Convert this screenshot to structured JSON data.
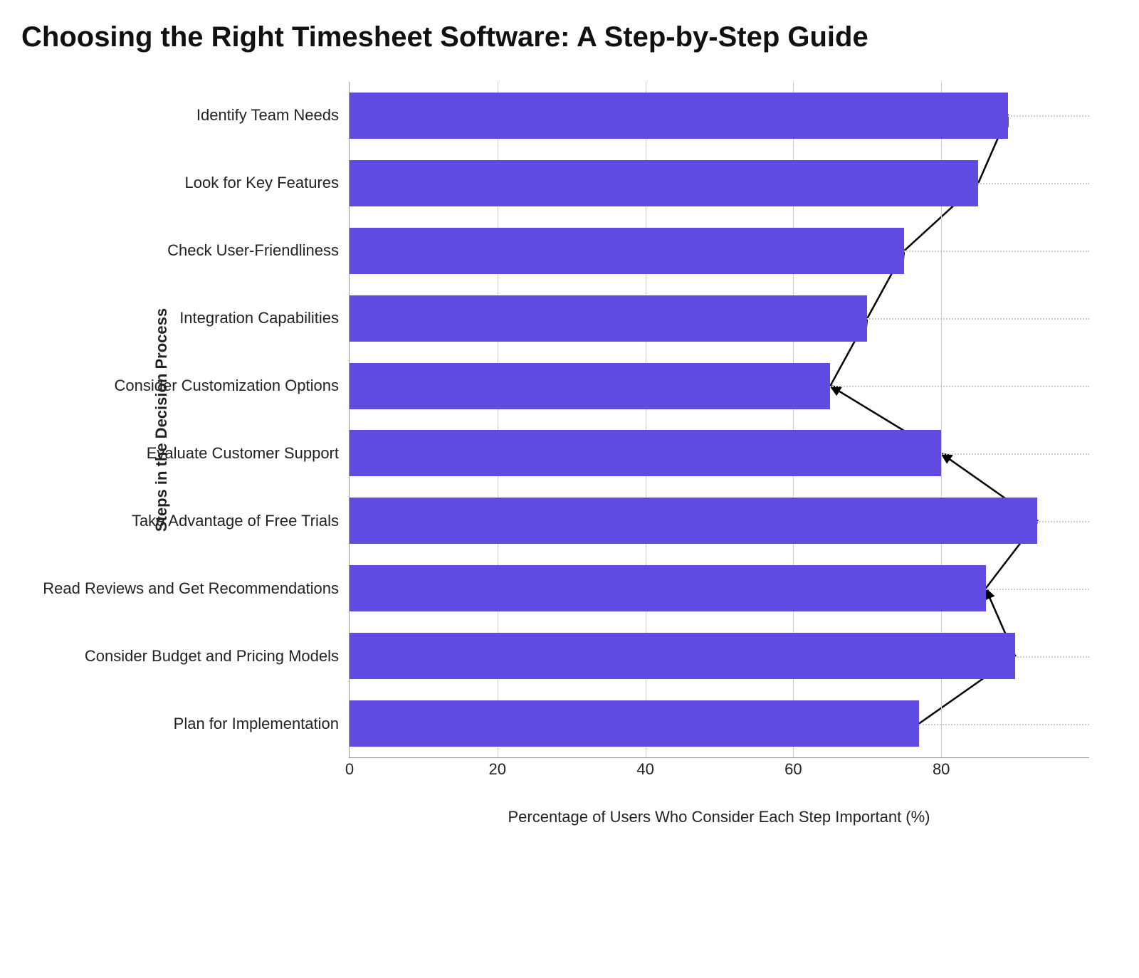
{
  "chart_data": {
    "type": "bar",
    "title": "Choosing the Right Timesheet Software: A Step-by-Step Guide",
    "xlabel": "Percentage of Users Who Consider Each Step Important (%)",
    "ylabel": "Steps in the Decision Process",
    "xlim": [
      0,
      100
    ],
    "xticks": [
      0,
      20,
      40,
      60,
      80
    ],
    "categories": [
      "Identify Team Needs",
      "Look for Key Features",
      "Check User-Friendliness",
      "Integration Capabilities",
      "Consider Customization Options",
      "Evaluate Customer Support",
      "Take Advantage of Free Trials",
      "Read Reviews and Get Recommendations",
      "Consider Budget and Pricing Models",
      "Plan for Implementation"
    ],
    "values": [
      89,
      85,
      75,
      70,
      65,
      80,
      93,
      86,
      90,
      77
    ],
    "bar_color": "#5f4be1",
    "arrows_between_bars": true
  }
}
